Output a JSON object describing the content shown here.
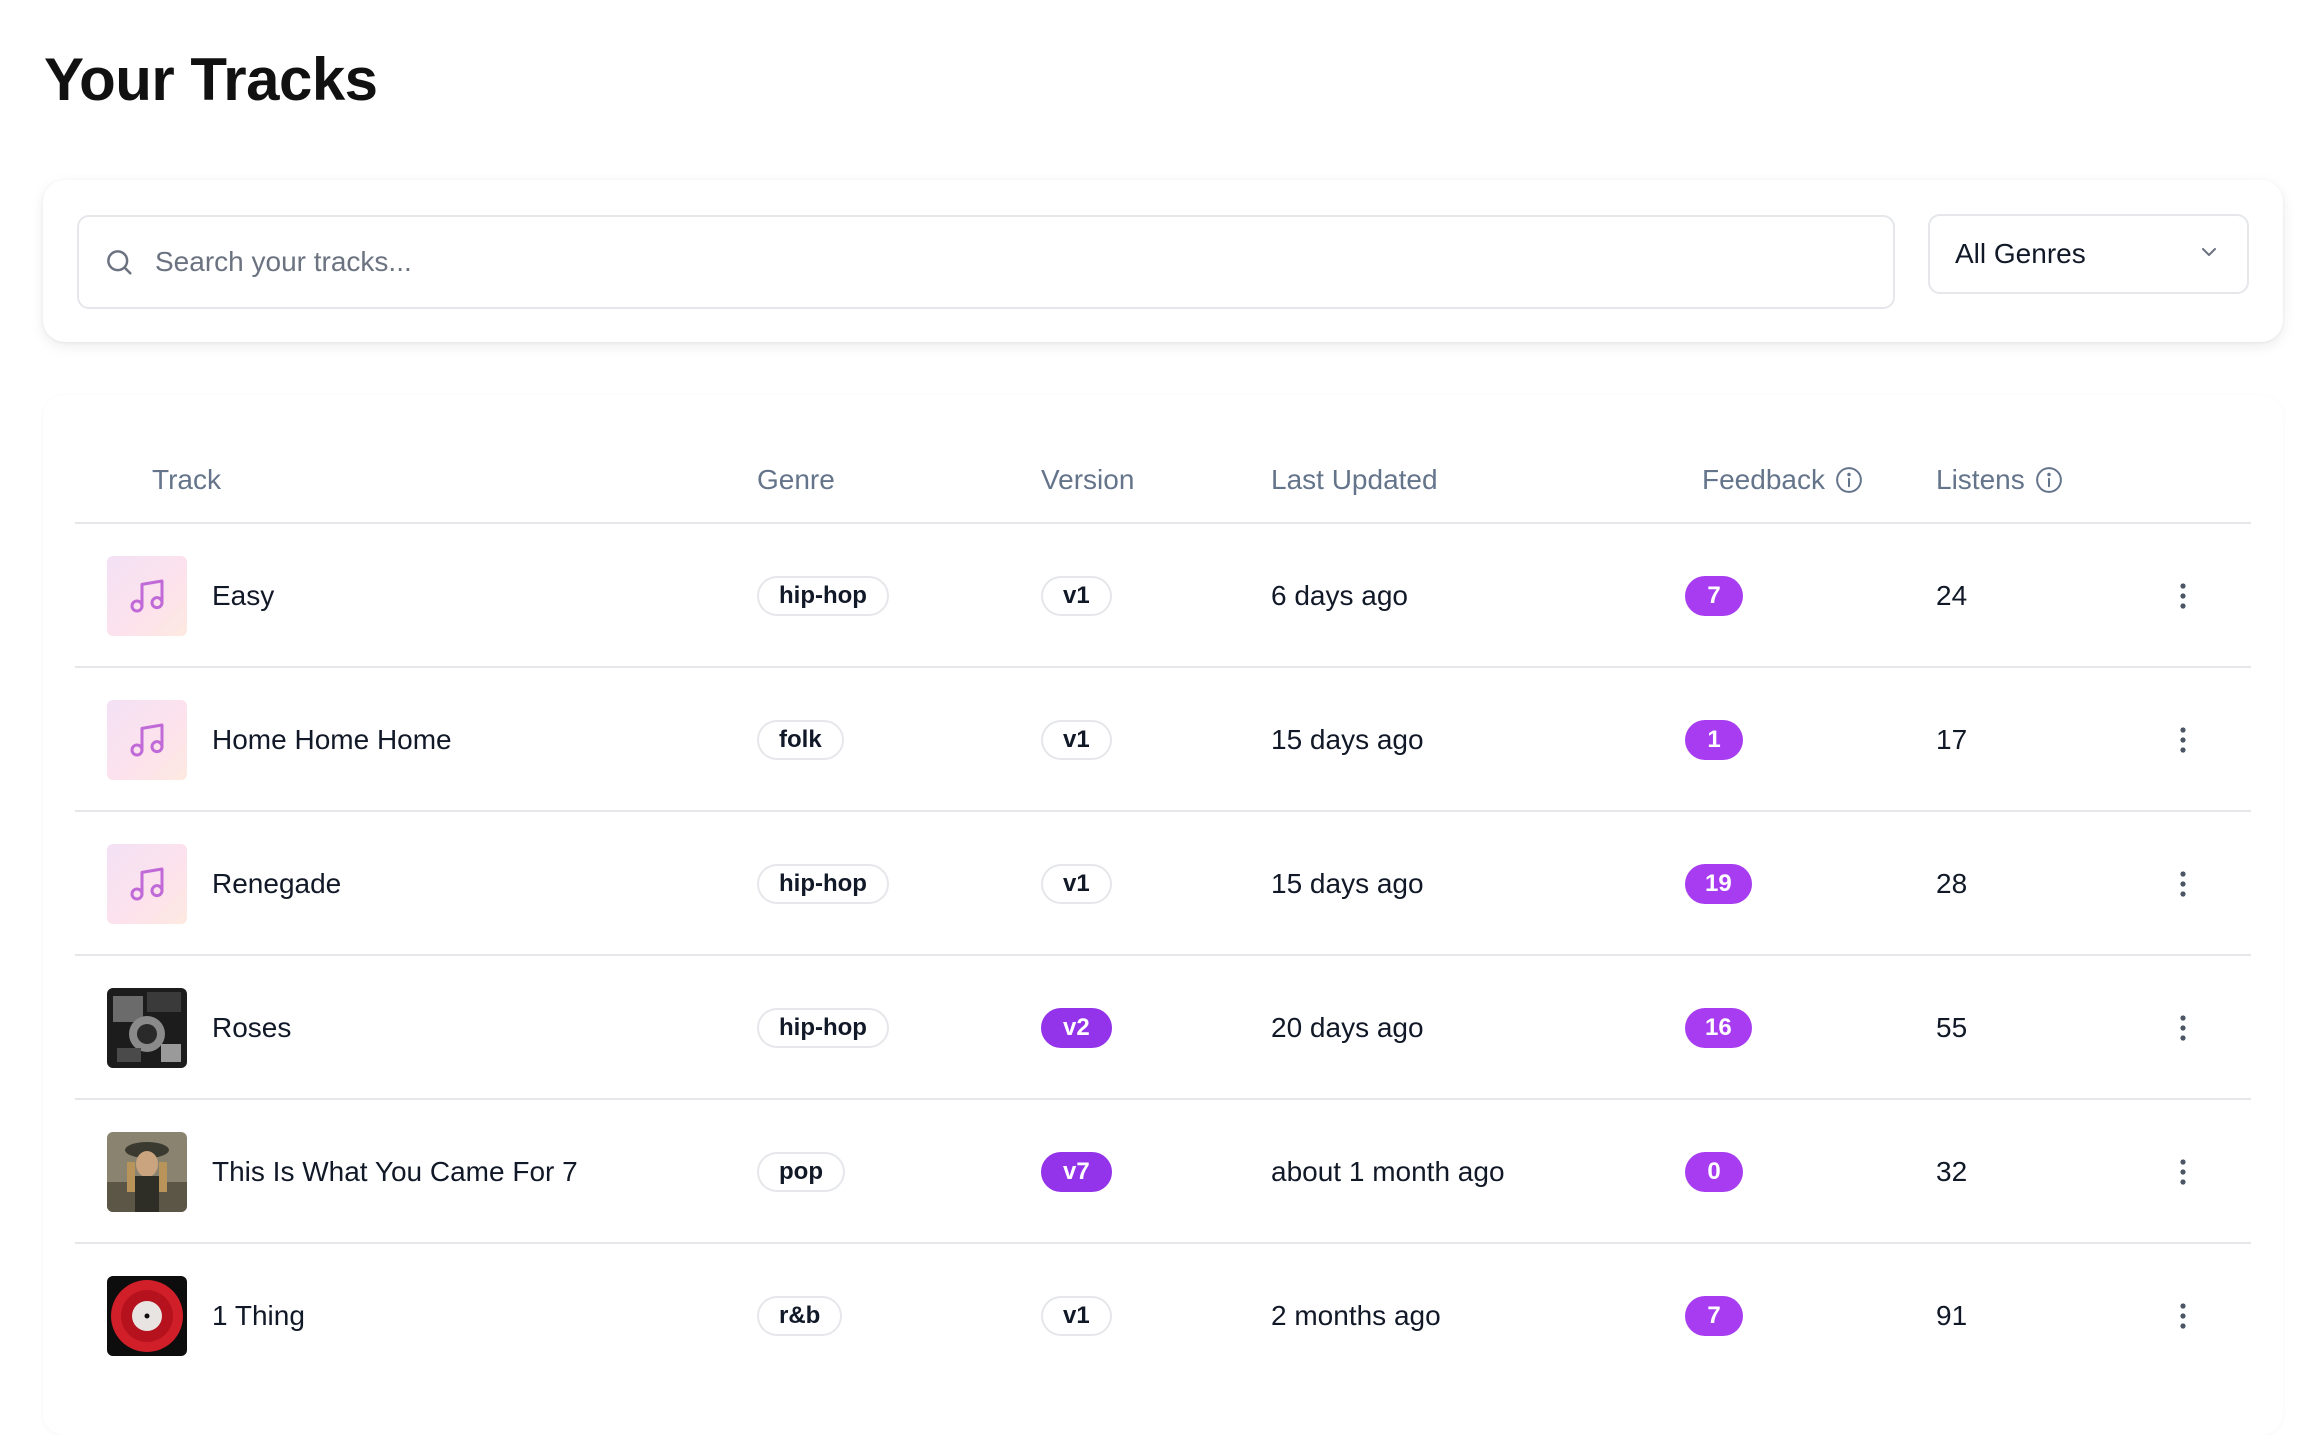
{
  "page": {
    "title": "Your Tracks"
  },
  "filters": {
    "search_placeholder": "Search your tracks...",
    "search_value": "",
    "genre_selected": "All Genres"
  },
  "table": {
    "headers": {
      "track": "Track",
      "genre": "Genre",
      "version": "Version",
      "last_updated": "Last Updated",
      "feedback": "Feedback",
      "listens": "Listens"
    },
    "rows": [
      {
        "title": "Easy",
        "genre": "hip-hop",
        "version": "v1",
        "version_highlight": false,
        "updated": "6 days ago",
        "feedback": "7",
        "listens": "24",
        "thumb": "music-note-icon"
      },
      {
        "title": "Home Home Home",
        "genre": "folk",
        "version": "v1",
        "version_highlight": false,
        "updated": "15 days ago",
        "feedback": "1",
        "listens": "17",
        "thumb": "music-note-icon"
      },
      {
        "title": "Renegade",
        "genre": "hip-hop",
        "version": "v1",
        "version_highlight": false,
        "updated": "15 days ago",
        "feedback": "19",
        "listens": "28",
        "thumb": "music-note-icon"
      },
      {
        "title": "Roses",
        "genre": "hip-hop",
        "version": "v2",
        "version_highlight": true,
        "updated": "20 days ago",
        "feedback": "16",
        "listens": "55",
        "thumb": "cover-art-bw"
      },
      {
        "title": "This Is What You Came For 7",
        "genre": "pop",
        "version": "v7",
        "version_highlight": true,
        "updated": "about 1 month ago",
        "feedback": "0",
        "listens": "32",
        "thumb": "cover-art-photo"
      },
      {
        "title": "1 Thing",
        "genre": "r&b",
        "version": "v1",
        "version_highlight": false,
        "updated": "2 months ago",
        "feedback": "7",
        "listens": "91",
        "thumb": "cover-art-vinyl"
      }
    ]
  },
  "colors": {
    "accent": "#9333ea",
    "feedback_badge": "#a73cf0",
    "muted_text": "#64748b",
    "border": "#e5e7eb"
  },
  "icons": {
    "search": "search-icon",
    "dropdown": "chevron-down-icon",
    "info": "info-icon",
    "row_menu": "more-vertical-icon",
    "placeholder_thumb": "music-note-icon"
  }
}
